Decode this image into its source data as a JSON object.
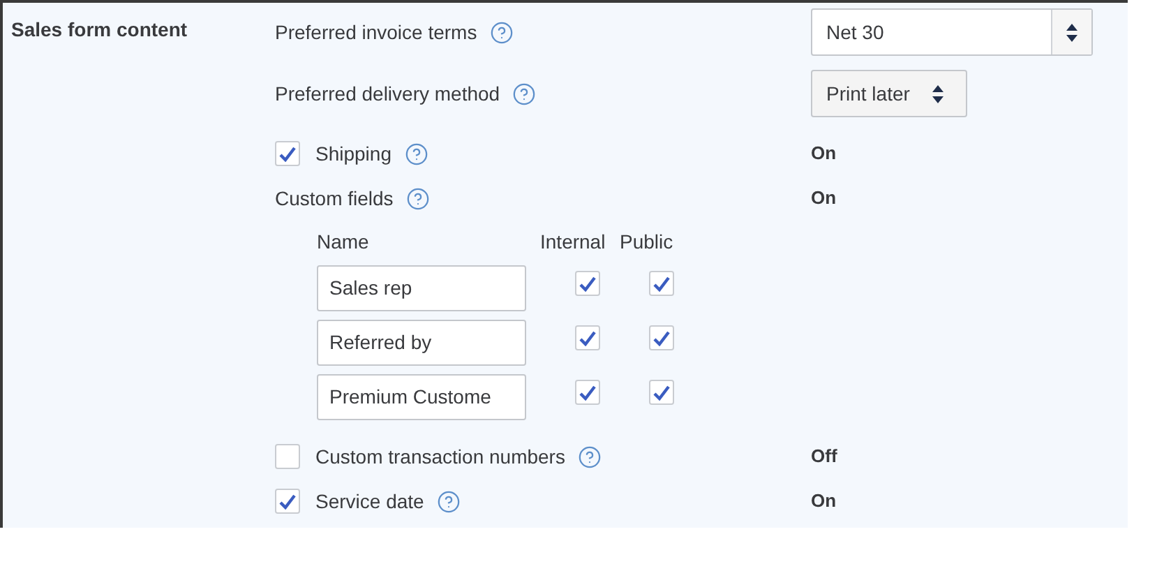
{
  "section": {
    "title": "Sales form content"
  },
  "settings": [
    {
      "kind": "select",
      "label": "Preferred invoice terms",
      "value": "Net 30",
      "wide": true
    },
    {
      "kind": "select",
      "label": "Preferred delivery method",
      "value": "Print later",
      "wide": false
    },
    {
      "kind": "checkbox",
      "label": "Shipping",
      "checked": true,
      "status": "On"
    },
    {
      "kind": "label",
      "label": "Custom fields",
      "status": "On"
    }
  ],
  "custom_fields": {
    "columns": [
      "Name",
      "Internal",
      "Public"
    ],
    "rows": [
      {
        "name": "Sales rep",
        "internal": true,
        "public": true
      },
      {
        "name": "Referred by",
        "internal": true,
        "public": true
      },
      {
        "name": "Premium Custome",
        "internal": true,
        "public": true
      }
    ]
  },
  "more_settings": [
    {
      "kind": "checkbox",
      "label": "Custom transaction numbers",
      "checked": false,
      "status": "Off"
    },
    {
      "kind": "checkbox",
      "label": "Service date",
      "checked": true,
      "status": "On"
    }
  ]
}
